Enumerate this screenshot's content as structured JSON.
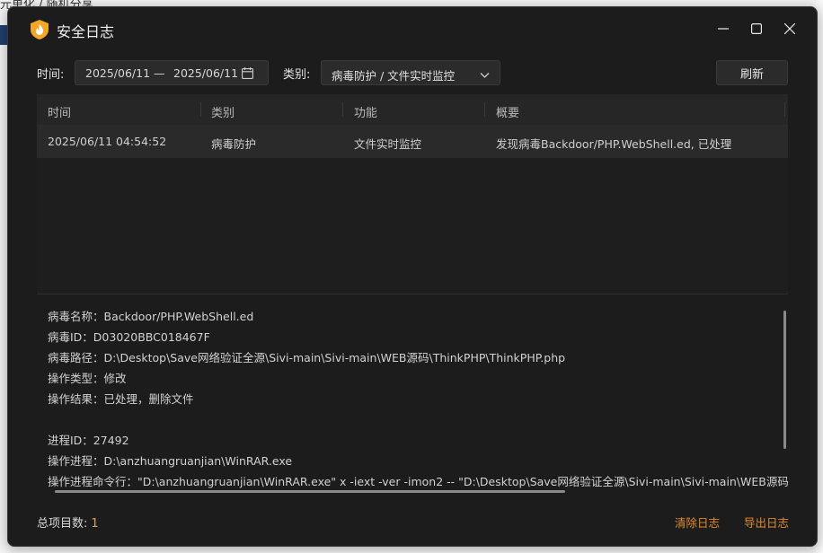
{
  "background": {
    "title_fragment": "元单化 / 随机分享"
  },
  "window": {
    "title": "安全日志",
    "icon": "flame-shield-icon",
    "accent": "#f5a623"
  },
  "filters": {
    "time_label": "时间:",
    "date_start": "2025/06/11",
    "date_separator": "—",
    "date_end": "2025/06/11",
    "category_label": "类别:",
    "category_value": "病毒防护 / 文件实时监控",
    "refresh_label": "刷新"
  },
  "table": {
    "columns": [
      "时间",
      "类别",
      "功能",
      "概要"
    ],
    "rows": [
      [
        "2025/06/11 04:54:52",
        "病毒防护",
        "文件实时监控",
        "发现病毒Backdoor/PHP.WebShell.ed, 已处理"
      ]
    ]
  },
  "detail": {
    "lines": [
      "病毒名称：Backdoor/PHP.WebShell.ed",
      "病毒ID：D03020BBC018467F",
      "病毒路径：D:\\Desktop\\Save网络验证全源\\Sivi-main\\Sivi-main\\WEB源码\\ThinkPHP\\ThinkPHP.php",
      "操作类型：修改",
      "操作结果：已处理，删除文件",
      "",
      "进程ID：27492",
      "操作进程：D:\\anzhuangruanjian\\WinRAR.exe",
      "操作进程命令行：\"D:\\anzhuangruanjian\\WinRAR.exe\" x -iext -ver -imon2 -- \"D:\\Desktop\\Save网络验证全源\\Sivi-main\\Sivi-main\\WEB源码.zip\" D:\\"
    ]
  },
  "footer": {
    "count_label": "总项目数:",
    "count_value": "1",
    "clear_label": "清除日志",
    "export_label": "导出日志"
  },
  "colors": {
    "window_bg": "#1c1c1c",
    "link": "#e08b2c"
  }
}
